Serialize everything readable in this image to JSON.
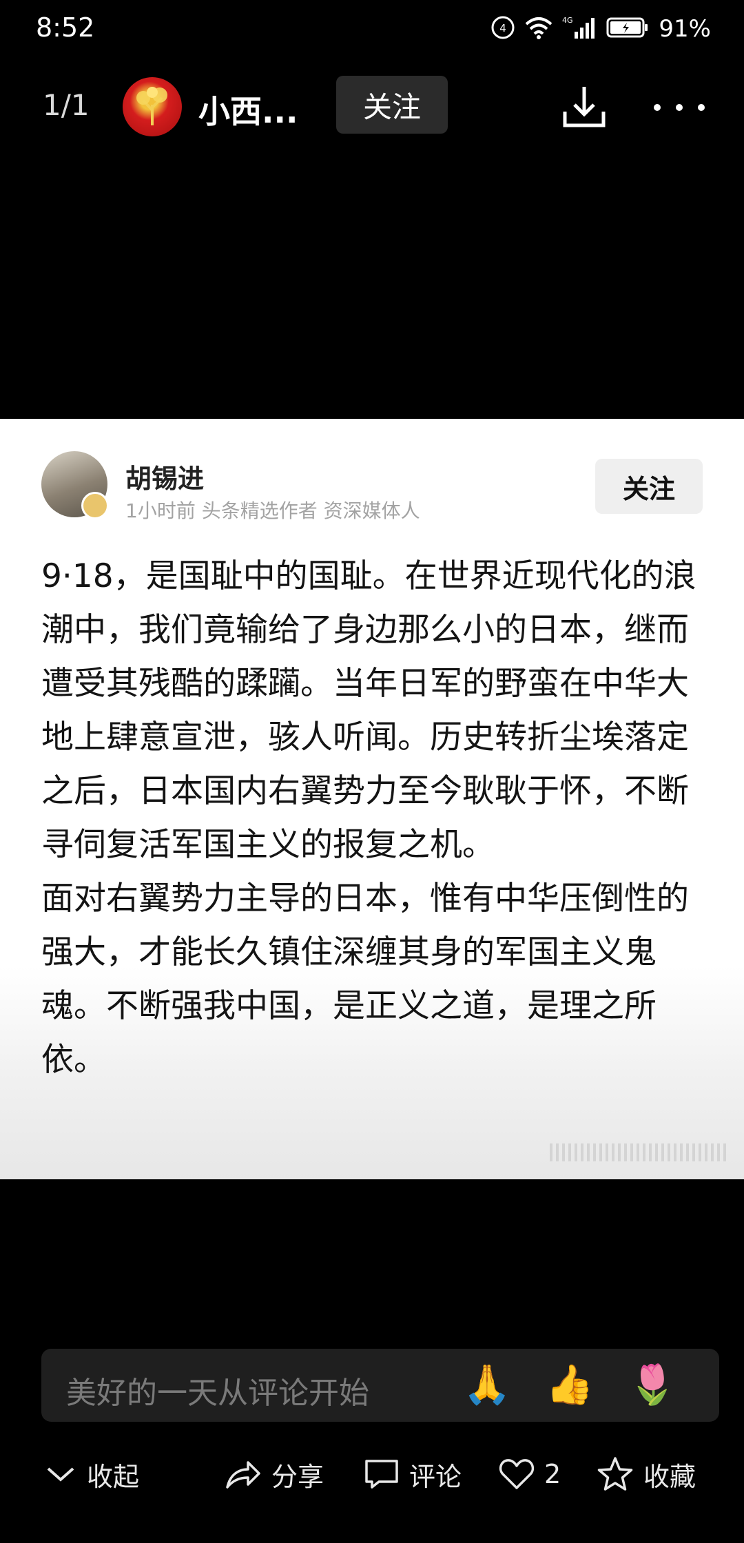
{
  "status_bar": {
    "time": "8:52",
    "network": "4G",
    "battery": "91%",
    "icons": [
      "hd-call-icon",
      "wifi-icon",
      "signal-icon",
      "battery-icon"
    ]
  },
  "top_bar": {
    "page_counter": "1/1",
    "author_name": "小西...",
    "follow_label": "关注",
    "icons": [
      "download-icon",
      "more-icon"
    ]
  },
  "post_card": {
    "author": "胡锡进",
    "meta": "1小时前  头条精选作者 资深媒体人",
    "follow_label": "关注",
    "paragraphs": [
      "9·18，是国耻中的国耻。在世界近现代化的浪潮中，我们竟输给了身边那么小的日本，继而遭受其残酷的蹂躏。当年日军的野蛮在中华大地上肆意宣泄，骇人听闻。历史转折尘埃落定之后，日本国内右翼势力至今耿耿于怀，不断寻伺复活军国主义的报复之机。",
      "面对右翼势力主导的日本，惟有中华压倒性的强大，才能长久镇住深缠其身的军国主义鬼魂。不断强我中国，是正义之道，是理之所依。"
    ]
  },
  "comment_bar": {
    "placeholder": "美好的一天从评论开始",
    "emojis": [
      "🙏",
      "👍",
      "🌷"
    ]
  },
  "bottom_actions": {
    "collapse": "收起",
    "share": "分享",
    "comment": "评论",
    "like_count": "2",
    "favorite": "收藏"
  }
}
